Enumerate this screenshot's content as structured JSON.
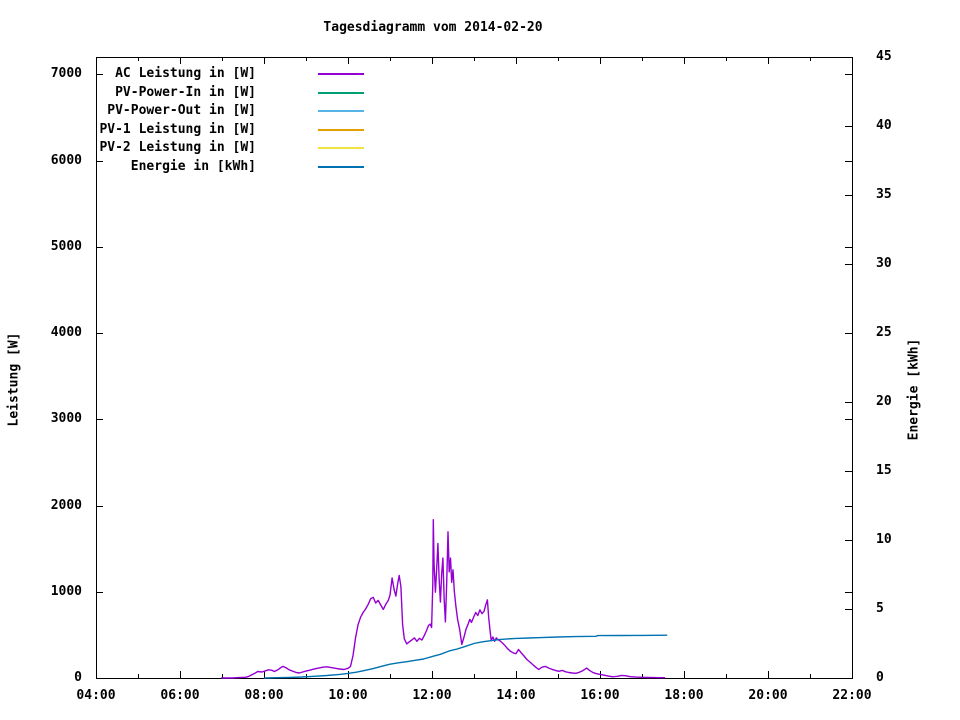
{
  "title": "Tagesdiagramm vom 2014-02-20",
  "axes": {
    "x": {
      "tick_labels": [
        "04:00",
        "06:00",
        "08:00",
        "10:00",
        "12:00",
        "14:00",
        "16:00",
        "18:00",
        "20:00",
        "22:00"
      ],
      "first_hour": 4,
      "last_hour": 22,
      "minor_tick_hours": [
        5,
        7,
        9,
        11,
        13,
        15,
        17,
        19,
        21
      ]
    },
    "y_left": {
      "label": "Leistung [W]",
      "ticks": [
        0,
        1000,
        2000,
        3000,
        4000,
        5000,
        6000,
        7000
      ],
      "range": [
        0,
        7200
      ]
    },
    "y_right": {
      "label": "Energie [kWh]",
      "ticks": [
        0,
        5,
        10,
        15,
        20,
        25,
        30,
        35,
        40,
        45
      ],
      "range": [
        0,
        45
      ]
    }
  },
  "legend": [
    {
      "label": "AC Leistung in [W]",
      "color": "#9400d3"
    },
    {
      "label": "PV-Power-In in [W]",
      "color": "#009e73"
    },
    {
      "label": "PV-Power-Out in [W]",
      "color": "#56b4e9"
    },
    {
      "label": "PV-1 Leistung in [W]",
      "color": "#e69f00"
    },
    {
      "label": "PV-2 Leistung in [W]",
      "color": "#f0e442"
    },
    {
      "label": "Energie in [kWh]",
      "color": "#0072b2"
    }
  ],
  "chart_data": {
    "type": "line",
    "title": "Tagesdiagramm vom 2014-02-20",
    "xlabel": "",
    "x_unit": "time of day (hours)",
    "x_range_hours": [
      4,
      22
    ],
    "y_left_label": "Leistung [W]",
    "y_left_range": [
      0,
      7200
    ],
    "y_right_label": "Energie [kWh]",
    "y_right_range": [
      0,
      45
    ],
    "grid": false,
    "legend_position": "top-left-inside",
    "series": [
      {
        "name": "AC Leistung in [W]",
        "color": "#9400d3",
        "axis": "left",
        "visible": true,
        "points": [
          [
            6.98,
            0
          ],
          [
            7.1,
            0
          ],
          [
            7.25,
            0
          ],
          [
            7.4,
            5
          ],
          [
            7.55,
            8
          ],
          [
            7.62,
            15
          ],
          [
            7.7,
            35
          ],
          [
            7.78,
            55
          ],
          [
            7.85,
            75
          ],
          [
            7.95,
            70
          ],
          [
            8.02,
            80
          ],
          [
            8.1,
            95
          ],
          [
            8.18,
            90
          ],
          [
            8.25,
            75
          ],
          [
            8.33,
            95
          ],
          [
            8.4,
            120
          ],
          [
            8.45,
            135
          ],
          [
            8.52,
            120
          ],
          [
            8.6,
            95
          ],
          [
            8.68,
            80
          ],
          [
            8.76,
            65
          ],
          [
            8.84,
            58
          ],
          [
            8.92,
            70
          ],
          [
            9.0,
            80
          ],
          [
            9.1,
            92
          ],
          [
            9.2,
            105
          ],
          [
            9.3,
            115
          ],
          [
            9.4,
            125
          ],
          [
            9.5,
            130
          ],
          [
            9.6,
            120
          ],
          [
            9.7,
            112
          ],
          [
            9.8,
            104
          ],
          [
            9.9,
            98
          ],
          [
            10.0,
            112
          ],
          [
            10.06,
            135
          ],
          [
            10.12,
            260
          ],
          [
            10.18,
            470
          ],
          [
            10.24,
            620
          ],
          [
            10.3,
            705
          ],
          [
            10.36,
            760
          ],
          [
            10.42,
            800
          ],
          [
            10.48,
            855
          ],
          [
            10.54,
            920
          ],
          [
            10.6,
            935
          ],
          [
            10.66,
            870
          ],
          [
            10.72,
            900
          ],
          [
            10.78,
            845
          ],
          [
            10.84,
            795
          ],
          [
            10.9,
            855
          ],
          [
            10.96,
            900
          ],
          [
            11.0,
            960
          ],
          [
            11.05,
            1160
          ],
          [
            11.1,
            1020
          ],
          [
            11.14,
            950
          ],
          [
            11.18,
            1090
          ],
          [
            11.22,
            1190
          ],
          [
            11.26,
            1060
          ],
          [
            11.3,
            620
          ],
          [
            11.34,
            455
          ],
          [
            11.4,
            395
          ],
          [
            11.46,
            420
          ],
          [
            11.52,
            440
          ],
          [
            11.58,
            465
          ],
          [
            11.64,
            425
          ],
          [
            11.7,
            460
          ],
          [
            11.76,
            440
          ],
          [
            11.82,
            495
          ],
          [
            11.87,
            550
          ],
          [
            11.92,
            610
          ],
          [
            11.96,
            625
          ],
          [
            11.99,
            585
          ],
          [
            12.02,
            1090
          ],
          [
            12.03,
            1835
          ],
          [
            12.05,
            1310
          ],
          [
            12.08,
            995
          ],
          [
            12.11,
            1250
          ],
          [
            12.14,
            1560
          ],
          [
            12.17,
            1160
          ],
          [
            12.2,
            880
          ],
          [
            12.23,
            1210
          ],
          [
            12.26,
            1390
          ],
          [
            12.29,
            905
          ],
          [
            12.32,
            650
          ],
          [
            12.35,
            1100
          ],
          [
            12.38,
            1695
          ],
          [
            12.41,
            1230
          ],
          [
            12.44,
            1390
          ],
          [
            12.47,
            1110
          ],
          [
            12.5,
            1255
          ],
          [
            12.53,
            1010
          ],
          [
            12.57,
            830
          ],
          [
            12.61,
            680
          ],
          [
            12.66,
            560
          ],
          [
            12.71,
            390
          ],
          [
            12.76,
            470
          ],
          [
            12.81,
            565
          ],
          [
            12.86,
            625
          ],
          [
            12.9,
            680
          ],
          [
            12.94,
            645
          ],
          [
            12.99,
            705
          ],
          [
            13.04,
            760
          ],
          [
            13.09,
            725
          ],
          [
            13.14,
            790
          ],
          [
            13.19,
            745
          ],
          [
            13.24,
            775
          ],
          [
            13.28,
            850
          ],
          [
            13.32,
            905
          ],
          [
            13.35,
            700
          ],
          [
            13.38,
            555
          ],
          [
            13.41,
            435
          ],
          [
            13.45,
            475
          ],
          [
            13.49,
            425
          ],
          [
            13.53,
            465
          ],
          [
            13.57,
            445
          ],
          [
            13.62,
            430
          ],
          [
            13.68,
            405
          ],
          [
            13.74,
            375
          ],
          [
            13.8,
            340
          ],
          [
            13.87,
            310
          ],
          [
            13.94,
            290
          ],
          [
            14.0,
            282
          ],
          [
            14.06,
            330
          ],
          [
            14.12,
            295
          ],
          [
            14.19,
            255
          ],
          [
            14.26,
            215
          ],
          [
            14.33,
            185
          ],
          [
            14.4,
            155
          ],
          [
            14.47,
            125
          ],
          [
            14.54,
            100
          ],
          [
            14.62,
            125
          ],
          [
            14.7,
            135
          ],
          [
            14.78,
            115
          ],
          [
            14.86,
            100
          ],
          [
            14.94,
            88
          ],
          [
            15.02,
            78
          ],
          [
            15.1,
            88
          ],
          [
            15.18,
            72
          ],
          [
            15.26,
            64
          ],
          [
            15.34,
            58
          ],
          [
            15.42,
            55
          ],
          [
            15.5,
            65
          ],
          [
            15.58,
            82
          ],
          [
            15.68,
            115
          ],
          [
            15.76,
            85
          ],
          [
            15.84,
            62
          ],
          [
            15.92,
            50
          ],
          [
            16.0,
            42
          ],
          [
            16.1,
            32
          ],
          [
            16.2,
            22
          ],
          [
            16.3,
            14
          ],
          [
            16.42,
            20
          ],
          [
            16.52,
            30
          ],
          [
            16.62,
            25
          ],
          [
            16.72,
            15
          ],
          [
            16.85,
            10
          ],
          [
            17.0,
            8
          ],
          [
            17.15,
            6
          ],
          [
            17.3,
            5
          ],
          [
            17.45,
            4
          ],
          [
            17.55,
            3
          ]
        ]
      },
      {
        "name": "PV-Power-In in [W]",
        "color": "#009e73",
        "axis": "left",
        "visible": false,
        "points": []
      },
      {
        "name": "PV-Power-Out in [W]",
        "color": "#56b4e9",
        "axis": "left",
        "visible": false,
        "points": []
      },
      {
        "name": "PV-1 Leistung in [W]",
        "color": "#e69f00",
        "axis": "left",
        "visible": false,
        "points": []
      },
      {
        "name": "PV-2 Leistung in [W]",
        "color": "#f0e442",
        "axis": "left",
        "visible": false,
        "points": []
      },
      {
        "name": "Energie in [kWh]",
        "color": "#0072b2",
        "axis": "right",
        "visible": true,
        "points": [
          [
            8.0,
            0
          ],
          [
            8.3,
            0.02
          ],
          [
            8.6,
            0.04
          ],
          [
            8.9,
            0.07
          ],
          [
            9.2,
            0.12
          ],
          [
            9.5,
            0.18
          ],
          [
            9.8,
            0.26
          ],
          [
            10.0,
            0.33
          ],
          [
            10.2,
            0.42
          ],
          [
            10.4,
            0.55
          ],
          [
            10.6,
            0.68
          ],
          [
            10.8,
            0.85
          ],
          [
            11.0,
            1.0
          ],
          [
            11.2,
            1.1
          ],
          [
            11.4,
            1.18
          ],
          [
            11.6,
            1.28
          ],
          [
            11.8,
            1.38
          ],
          [
            12.0,
            1.55
          ],
          [
            12.2,
            1.72
          ],
          [
            12.4,
            1.95
          ],
          [
            12.6,
            2.1
          ],
          [
            12.8,
            2.3
          ],
          [
            13.0,
            2.5
          ],
          [
            13.2,
            2.62
          ],
          [
            13.4,
            2.7
          ],
          [
            13.6,
            2.78
          ],
          [
            13.8,
            2.83
          ],
          [
            14.0,
            2.87
          ],
          [
            14.3,
            2.9
          ],
          [
            14.6,
            2.93
          ],
          [
            15.0,
            2.97
          ],
          [
            15.4,
            3.0
          ],
          [
            15.9,
            3.02
          ],
          [
            15.95,
            3.07
          ],
          [
            16.5,
            3.08
          ],
          [
            17.0,
            3.09
          ],
          [
            17.6,
            3.1
          ]
        ]
      }
    ]
  }
}
